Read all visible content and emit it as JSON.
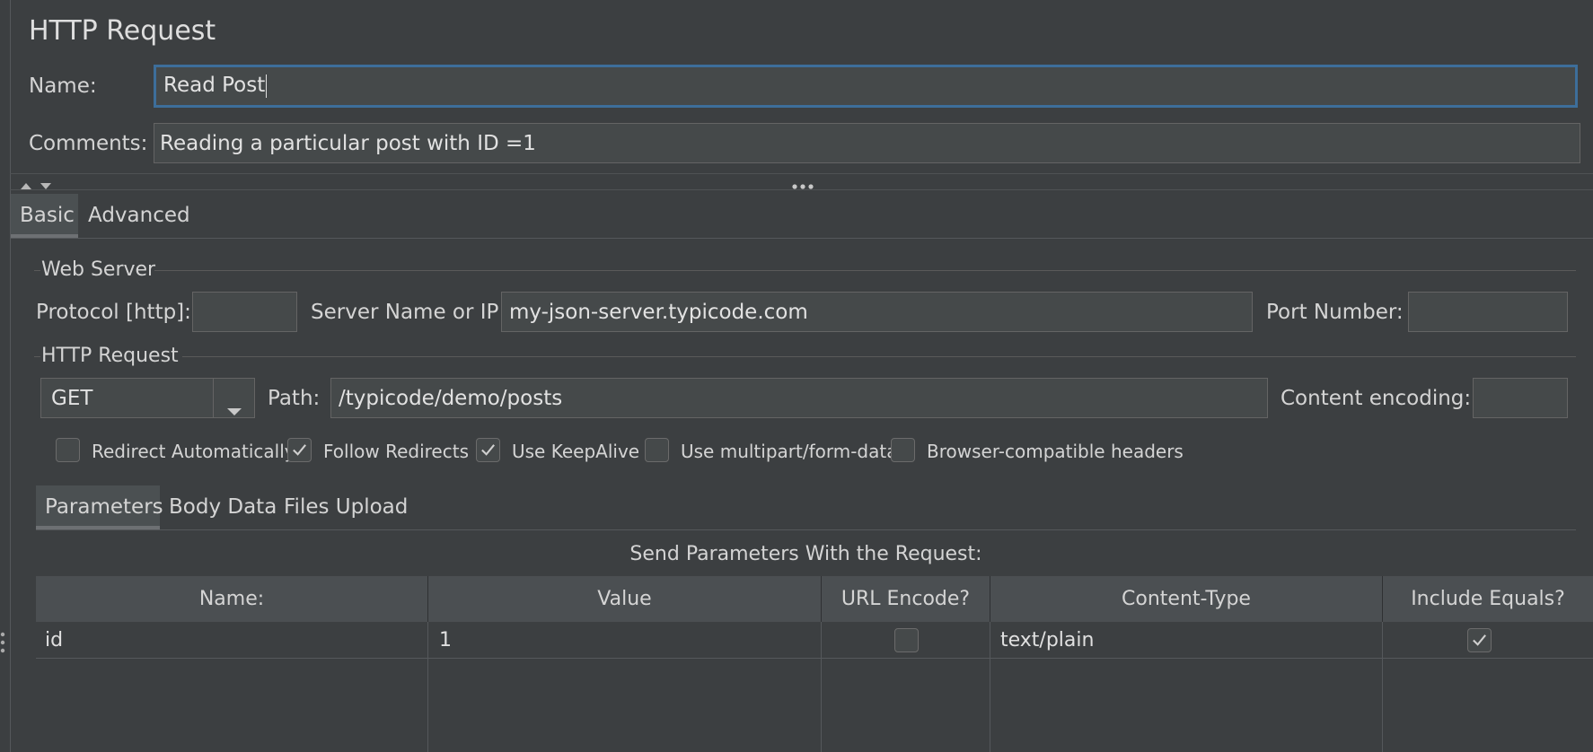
{
  "panel": {
    "title": "HTTP Request",
    "name_label": "Name:",
    "name_value": "Read Post",
    "comments_label": "Comments:",
    "comments_value": "Reading a particular post with ID =1"
  },
  "tabs": {
    "basic": "Basic",
    "advanced": "Advanced",
    "selected": "Basic"
  },
  "web_server": {
    "group_label": "Web Server",
    "protocol_label": "Protocol [http]:",
    "protocol_value": "",
    "server_label": "Server Name or IP:",
    "server_value": "my-json-server.typicode.com",
    "port_label": "Port Number:",
    "port_value": ""
  },
  "http_request": {
    "group_label": "HTTP Request",
    "method": "GET",
    "path_label": "Path:",
    "path_value": "/typicode/demo/posts",
    "encoding_label": "Content encoding:",
    "encoding_value": ""
  },
  "options": [
    {
      "label": "Redirect Automatically",
      "checked": false
    },
    {
      "label": "Follow Redirects",
      "checked": true
    },
    {
      "label": "Use KeepAlive",
      "checked": true
    },
    {
      "label": "Use multipart/form-data",
      "checked": false
    },
    {
      "label": "Browser-compatible headers",
      "checked": false
    }
  ],
  "subtabs": {
    "parameters": "Parameters",
    "body_data": "Body Data",
    "files_upload": "Files Upload",
    "selected": "Parameters"
  },
  "params": {
    "caption": "Send Parameters With the Request:",
    "columns": [
      "Name:",
      "Value",
      "URL Encode?",
      "Content-Type",
      "Include Equals?"
    ],
    "rows": [
      {
        "name": "id",
        "value": "1",
        "url_encode": false,
        "content_type": "text/plain",
        "include_equals": true
      }
    ]
  },
  "colors": {
    "background": "#3c3f41",
    "focus_border": "#3d6e9a",
    "field": "#45494a"
  },
  "icons": [
    "collapse-up-icon",
    "collapse-down-icon",
    "splitter-dots-icon",
    "dropdown-arrow-icon",
    "checkmark-icon",
    "side-grip-icon"
  ]
}
